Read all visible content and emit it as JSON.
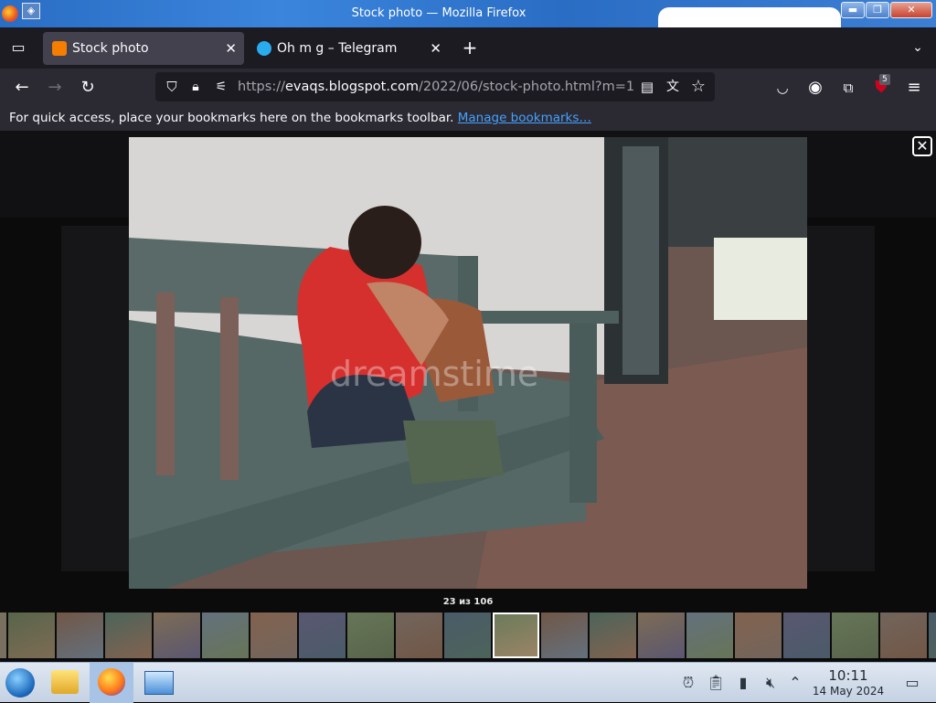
{
  "window": {
    "title": "Stock photo — Mozilla Firefox"
  },
  "tabs": [
    {
      "label": "Stock photo",
      "favicon_color": "#f57d00"
    },
    {
      "label": "Oh m g – Telegram",
      "favicon_color": "#2aabee"
    }
  ],
  "navbar": {
    "url_prefix": "https://",
    "url_host": "evaqs.blogspot.com",
    "url_path": "/2022/06/stock-photo.html?m=1",
    "extension_badge": "5"
  },
  "bookmarks": {
    "message": "For quick access, place your bookmarks here on the bookmarks toolbar.",
    "link": "Manage bookmarks…"
  },
  "lightbox": {
    "counter": "23 из 106",
    "close_icon": "close-icon",
    "watermark": "dreamstime",
    "thumbnail_count": 20,
    "selected_thumbnail": 10
  },
  "colors": {
    "accent_link": "#45a1ff",
    "titlebar": "#2a6dc4",
    "tab_active": "#42414d"
  },
  "taskbar": {
    "time": "10:11",
    "date": "14 May 2024"
  }
}
